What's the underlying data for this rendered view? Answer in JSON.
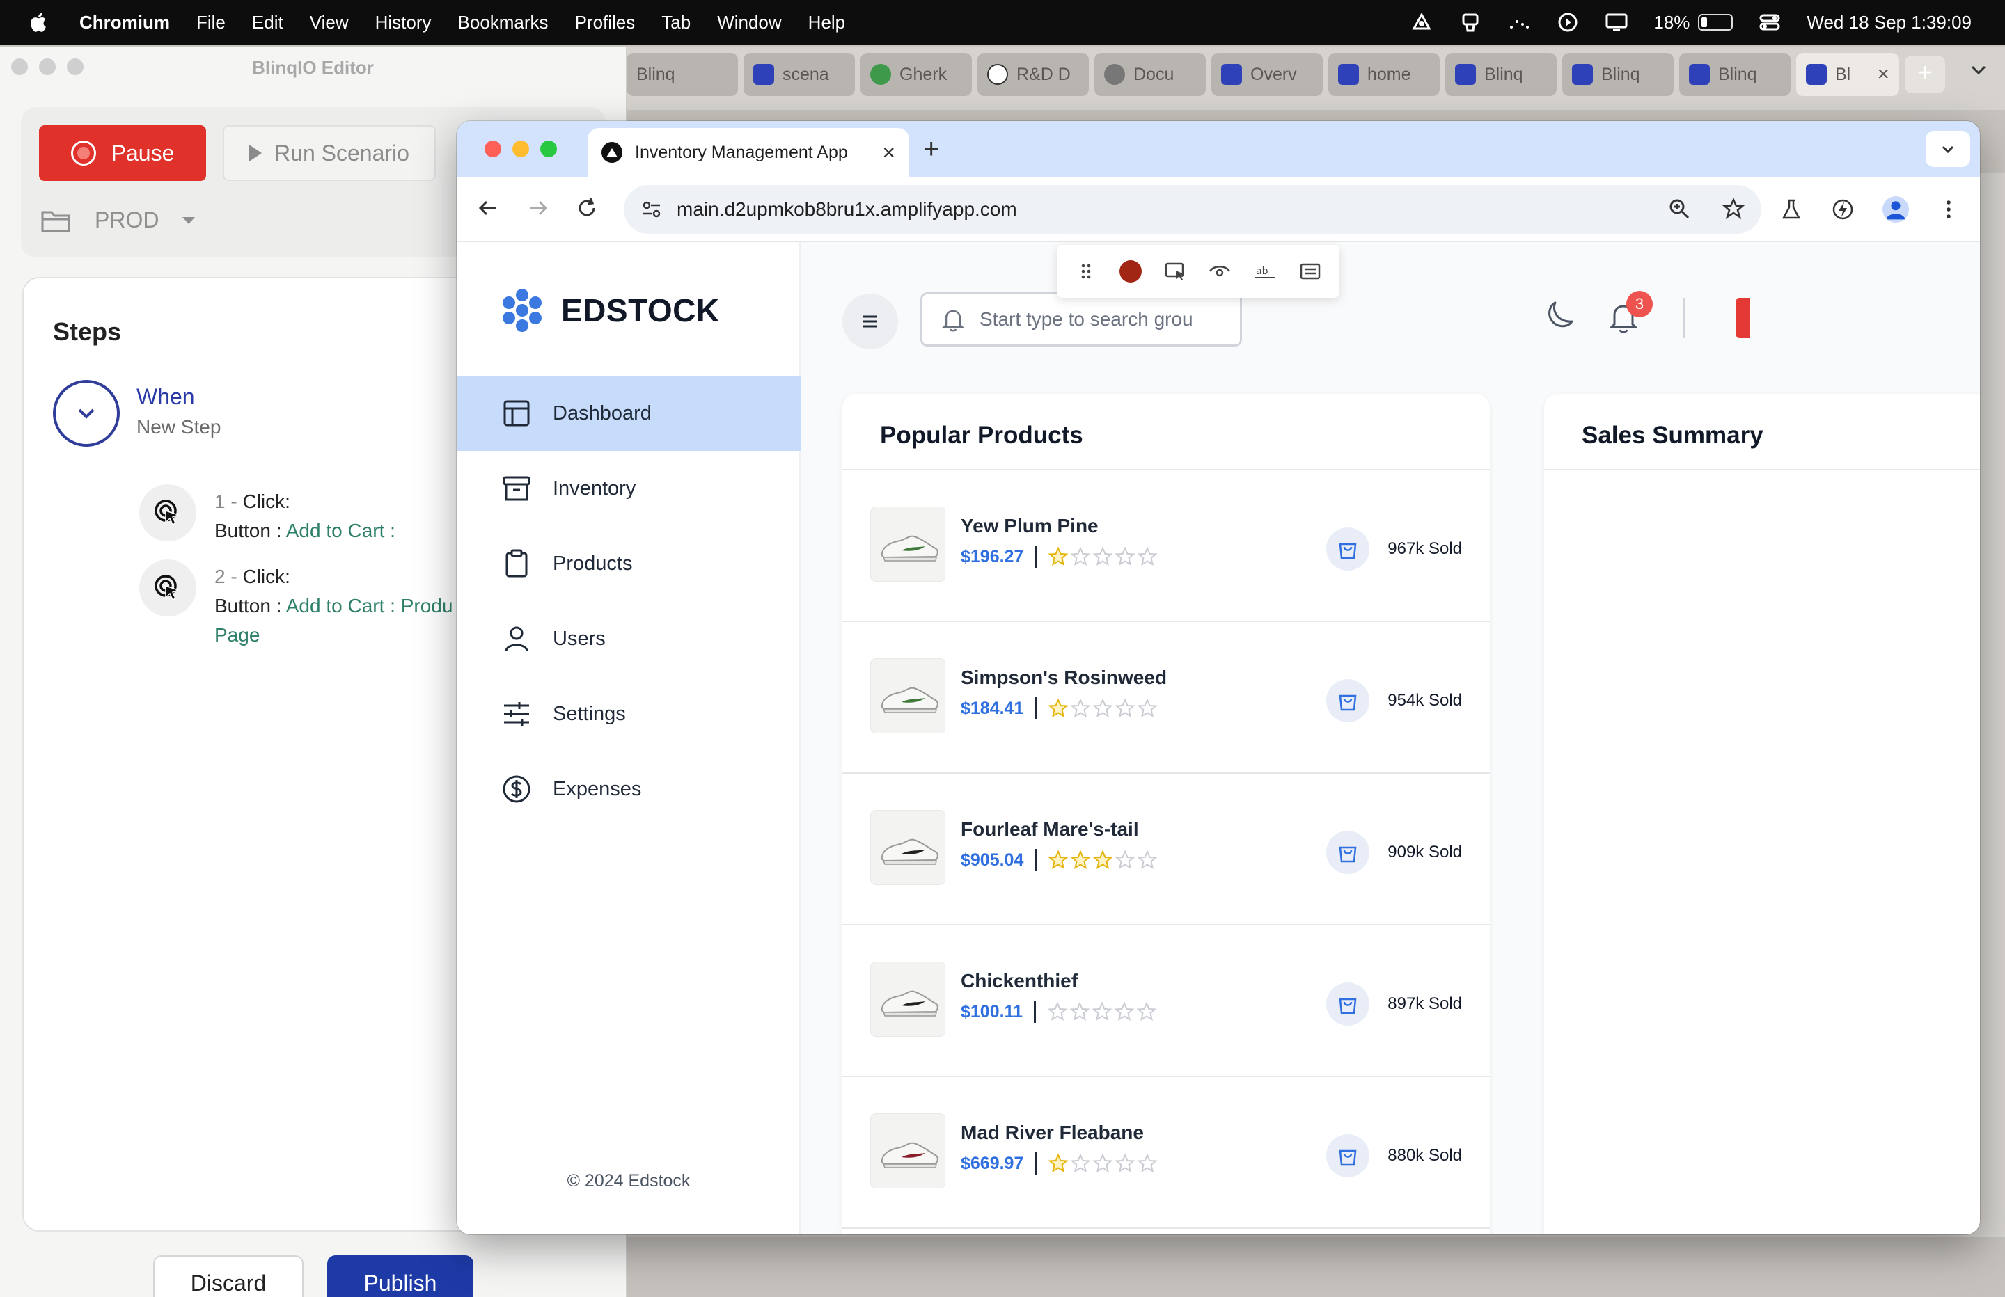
{
  "menubar": {
    "app": "Chromium",
    "items": [
      "File",
      "Edit",
      "View",
      "History",
      "Bookmarks",
      "Profiles",
      "Tab",
      "Window",
      "Help"
    ],
    "battery": "18%",
    "clock": "Wed 18 Sep  1:39:09"
  },
  "background_tabs": [
    {
      "label": "Blinq"
    },
    {
      "label": "scena"
    },
    {
      "label": "Gherk"
    },
    {
      "label": "R&D D"
    },
    {
      "label": "Docu"
    },
    {
      "label": "Overv"
    },
    {
      "label": "home"
    },
    {
      "label": "Blinq"
    },
    {
      "label": "Blinq"
    },
    {
      "label": "Blinq"
    },
    {
      "label": "Bl"
    }
  ],
  "editor": {
    "title": "BlinqIO Editor",
    "pause_label": "Pause",
    "run_label": "Run Scenario",
    "environment": "PROD",
    "steps_title": "Steps",
    "when_label": "When",
    "when_sub": "New Step",
    "steps": [
      {
        "num": "1",
        "action": "Click:",
        "target_prefix": "Button : ",
        "target": "Add to Cart :",
        "target_cont": ""
      },
      {
        "num": "2",
        "action": "Click:",
        "target_prefix": "Button : ",
        "target": "Add to Cart : Produ",
        "target_cont": "Page"
      }
    ],
    "discard_label": "Discard",
    "publish_label": "Publish"
  },
  "browser": {
    "tab_title": "Inventory Management App",
    "url": "main.d2upmkob8bru1x.amplifyapp.com"
  },
  "app": {
    "brand": "EDSTOCK",
    "nav": [
      {
        "label": "Dashboard",
        "icon": "layout-icon",
        "active": true
      },
      {
        "label": "Inventory",
        "icon": "archive-icon",
        "active": false
      },
      {
        "label": "Products",
        "icon": "clipboard-icon",
        "active": false
      },
      {
        "label": "Users",
        "icon": "user-icon",
        "active": false
      },
      {
        "label": "Settings",
        "icon": "sliders-icon",
        "active": false
      },
      {
        "label": "Expenses",
        "icon": "dollar-circle-icon",
        "active": false
      }
    ],
    "footer": "© 2024 Edstock",
    "search_placeholder": "Start type to search grou",
    "notification_count": "3",
    "popular_title": "Popular Products",
    "sales_title": "Sales Summary",
    "products": [
      {
        "name": "Yew Plum Pine",
        "price": "$196.27",
        "rating": 1,
        "sold": "967k Sold",
        "accent": "#3f7a3a"
      },
      {
        "name": "Simpson's Rosinweed",
        "price": "$184.41",
        "rating": 1,
        "sold": "954k Sold",
        "accent": "#3f7a3a"
      },
      {
        "name": "Fourleaf Mare's-tail",
        "price": "$905.04",
        "rating": 3,
        "sold": "909k Sold",
        "accent": "#222222"
      },
      {
        "name": "Chickenthief",
        "price": "$100.11",
        "rating": 0,
        "sold": "897k Sold",
        "accent": "#222222"
      },
      {
        "name": "Mad River Fleabane",
        "price": "$669.97",
        "rating": 1,
        "sold": "880k Sold",
        "accent": "#8a1d2a"
      }
    ]
  },
  "colors": {
    "accent_blue": "#2f6fe0",
    "pause_red": "#e0322a",
    "publish_blue": "#1d3aa7",
    "active_nav": "#c7dcfb",
    "star_gold": "#e5b40b"
  }
}
